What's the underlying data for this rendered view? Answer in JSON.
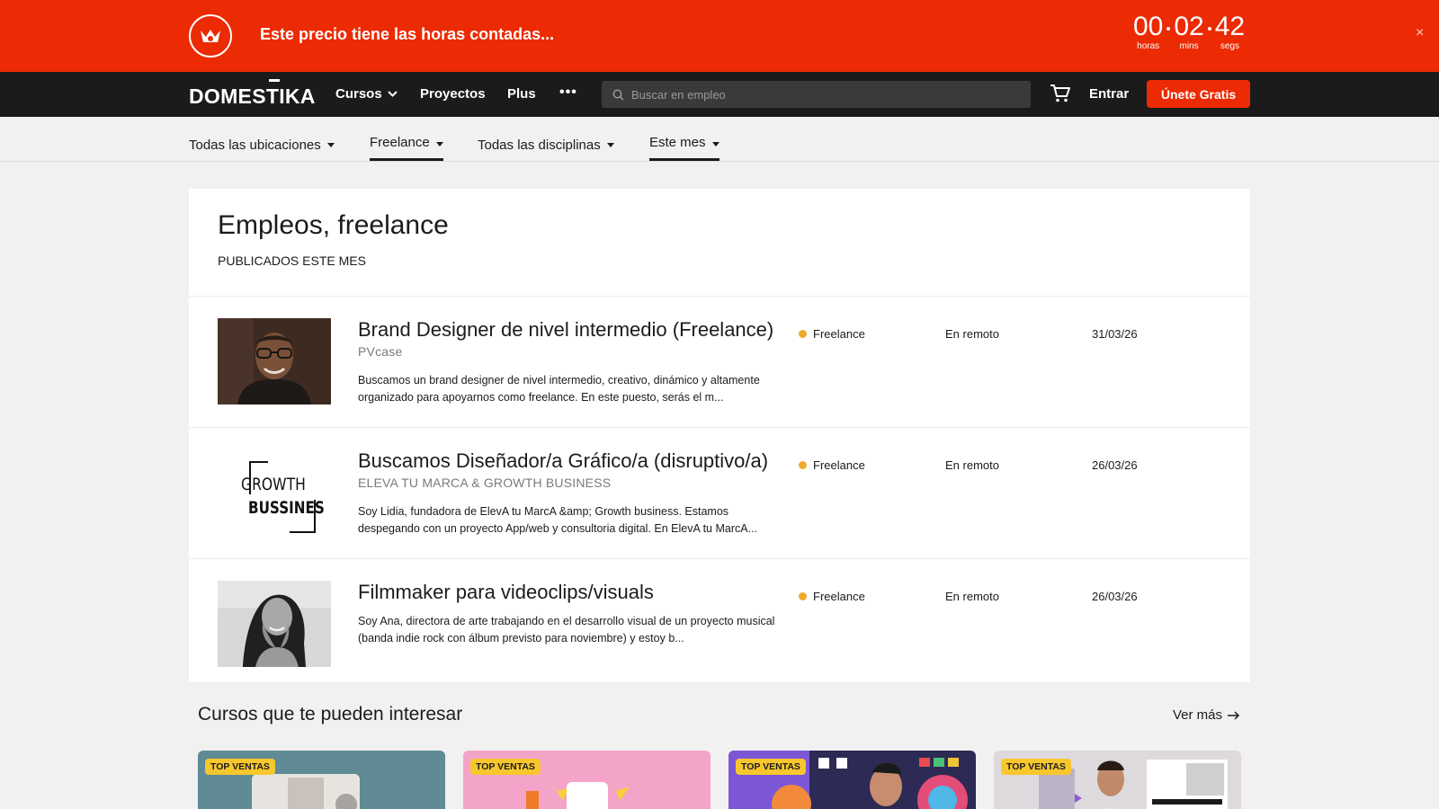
{
  "promo": {
    "text": "Este precio tiene las horas contadas...",
    "countdown": [
      {
        "value": "00",
        "label": "horas"
      },
      {
        "value": "02",
        "label": "mins"
      },
      {
        "value": "42",
        "label": "segs"
      }
    ],
    "close": "×",
    "color": "#ec2a04"
  },
  "nav": {
    "brand": "DOMESTIKA",
    "items": [
      {
        "label": "Cursos"
      },
      {
        "label": "Proyectos"
      },
      {
        "label": "Plus"
      }
    ],
    "more": "•••",
    "search_placeholder": "Buscar en empleo",
    "login": "Entrar",
    "join": "Únete Gratis"
  },
  "filters": [
    {
      "label": "Todas las ubicaciones",
      "active": false
    },
    {
      "label": "Freelance",
      "active": true
    },
    {
      "label": "Todas las disciplinas",
      "active": false
    },
    {
      "label": "Este mes",
      "active": true
    }
  ],
  "header": {
    "title": "Empleos, freelance",
    "subtitle": "PUBLICADOS ESTE MES"
  },
  "jobs": [
    {
      "title": "Brand Designer de nivel intermedio (Freelance)",
      "company": "PVcase",
      "description": "Buscamos un brand designer de nivel intermedio, creativo, dinámico y altamente organizado para apoyarnos como freelance. En este puesto, serás el m...",
      "type": "Freelance",
      "location": "En remoto",
      "date": "31/03/26"
    },
    {
      "title": "Buscamos Diseñador/a Gráfico/a (disruptivo/a)",
      "company": "ELEVA TU MARCA & GROWTH BUSINESS",
      "description": "Soy Lidia, fundadora de ElevA tu MarcA &amp; Growth business. Estamos despegando con un proyecto App/web y consultoria digital. En ElevA tu MarcA...",
      "type": "Freelance",
      "location": "En remoto",
      "date": "26/03/26",
      "logo_lines": [
        "GROWTH",
        "BUSSINES"
      ]
    },
    {
      "title": "Filmmaker para videoclips/visuals",
      "company": "",
      "description": "Soy Ana, directora de arte trabajando en el desarrollo visual de un proyecto musical (banda indie rock con álbum previsto para noviembre) y estoy b...",
      "type": "Freelance",
      "location": "En remoto",
      "date": "26/03/26"
    }
  ],
  "courses": {
    "title": "Cursos que te pueden interesar",
    "see_more": "Ver más",
    "items": [
      {
        "badge": "TOP VENTAS"
      },
      {
        "badge": "TOP VENTAS"
      },
      {
        "badge": "TOP VENTAS"
      },
      {
        "badge": "TOP VENTAS"
      }
    ]
  }
}
